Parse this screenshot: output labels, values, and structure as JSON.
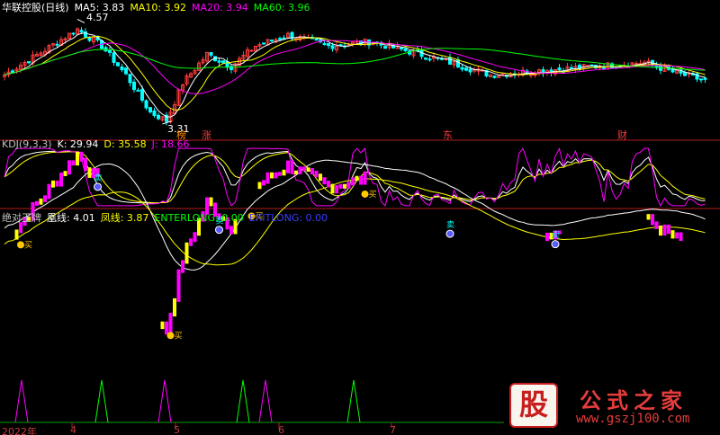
{
  "title": "华联控股(日线)",
  "ma_labels": [
    {
      "text": "MA5: 3.83",
      "color": "#ffffff"
    },
    {
      "text": "MA10: 3.92",
      "color": "#ffff00"
    },
    {
      "text": "MA20: 3.94",
      "color": "#ff00ff"
    },
    {
      "text": "MA60: 3.96",
      "color": "#00ff00"
    }
  ],
  "kdj_labels": [
    {
      "text": "KDJ(9,3,3)",
      "color": "#c0c0c0"
    },
    {
      "text": "K: 29.94",
      "color": "#ffffff"
    },
    {
      "text": "D: 35.58",
      "color": "#ffff00"
    },
    {
      "text": "J: 18.66",
      "color": "#ff00ff"
    }
  ],
  "ind_labels": [
    {
      "text": "绝对王牌",
      "color": "#c0c0c0"
    },
    {
      "text": "凰线: 4.01",
      "color": "#ffffff"
    },
    {
      "text": "凤线: 3.87",
      "color": "#ffff00"
    },
    {
      "text": "ENTERLONG: 0.00",
      "color": "#00ff00"
    },
    {
      "text": "EXITLONG: 0.00",
      "color": "#3c3cff"
    }
  ],
  "annotations": {
    "high": "4.57",
    "low": "3.31",
    "marks": [
      {
        "text": "榜",
        "color": "#ff8c00"
      },
      {
        "text": "涨",
        "color": "#ff3c3c"
      },
      {
        "text": "东",
        "color": "#ff3c3c"
      },
      {
        "text": "财",
        "color": "#ff3c3c"
      }
    ],
    "buy": "买",
    "sell": "卖"
  },
  "x_labels": [
    "2022年",
    "4",
    "5",
    "6",
    "7"
  ],
  "logo": {
    "big": "股",
    "name": "公式之家",
    "url": "www.gszj100.com"
  },
  "colors": {
    "up": "#ff3c3c",
    "down": "#00ffff",
    "ma5": "#ffffff",
    "ma10": "#ffff00",
    "ma20": "#ff00ff",
    "ma60": "#00ff00",
    "divider": "#b41e1e",
    "magenta_bar": "#ff00ff",
    "yellow_bar": "#ffff00"
  },
  "chart_data": {
    "type": "candlestick",
    "n_bars": 174,
    "price_ylim": [
      3.2,
      4.65
    ],
    "highlighted_high": 4.57,
    "highlighted_low": 3.31,
    "last_values": {
      "MA5": 3.83,
      "MA10": 3.92,
      "MA20": 3.94,
      "MA60": 3.96,
      "K": 29.94,
      "D": 35.58,
      "J": 18.66,
      "凰线": 4.01,
      "凤线": 3.87
    },
    "enterlong_signals": [
      4,
      41,
      61,
      89
    ],
    "exitlong_signals": [
      23,
      53,
      110,
      136
    ]
  }
}
